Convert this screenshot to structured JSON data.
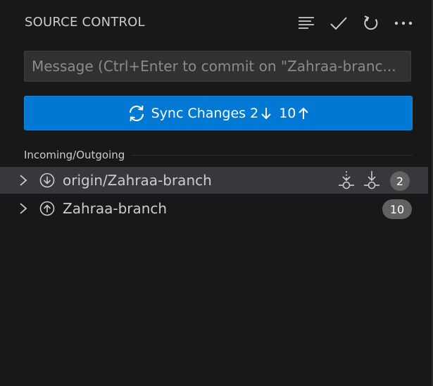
{
  "header": {
    "title": "SOURCE CONTROL",
    "actions": [
      {
        "name": "view-as-tree",
        "icon": "list-icon"
      },
      {
        "name": "commit",
        "icon": "check-icon"
      },
      {
        "name": "refresh",
        "icon": "refresh-icon"
      },
      {
        "name": "more-actions",
        "icon": "ellipsis-icon"
      }
    ]
  },
  "commit": {
    "placeholder": "Message (Ctrl+Enter to commit on \"Zahraa-branc...",
    "value": ""
  },
  "sync": {
    "label": "Sync Changes",
    "incoming": "2",
    "outgoing": "10",
    "icon": "sync-icon"
  },
  "section": {
    "label": "Incoming/Outgoing"
  },
  "rows": [
    {
      "label": "origin/Zahraa-branch",
      "icon": "arrow-circle-down-icon",
      "count": "2",
      "selected": true,
      "actions": [
        "fetch-icon",
        "pull-icon"
      ]
    },
    {
      "label": "Zahraa-branch",
      "icon": "arrow-circle-up-icon",
      "count": "10",
      "selected": false
    }
  ],
  "colors": {
    "background": "#181818",
    "accent": "#0078d4",
    "selection": "#37373d",
    "badge": "#616161",
    "input_background": "#313131"
  }
}
